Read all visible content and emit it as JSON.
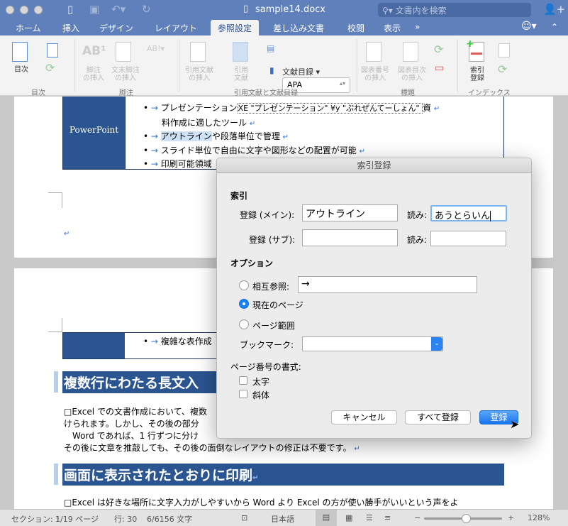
{
  "window": {
    "title": "sample14.docx",
    "search_placeholder": "文書内を検索"
  },
  "tabs": [
    {
      "label": "ホーム"
    },
    {
      "label": "挿入"
    },
    {
      "label": "デザイン"
    },
    {
      "label": "レイアウト"
    },
    {
      "label": "参照設定",
      "active": true
    },
    {
      "label": "差し込み文書"
    },
    {
      "label": "校閲"
    },
    {
      "label": "表示"
    },
    {
      "label": "»"
    }
  ],
  "ribbon": {
    "toc": {
      "button": "目次",
      "group": "目次"
    },
    "footnote": {
      "insert_footnote": "脚注\nの挿入",
      "insert_endnote": "文末脚注\nの挿入",
      "group": "脚注"
    },
    "citations": {
      "insert_citation": "引用文献\nの挿入",
      "citations": "引用\n文献",
      "style": "APA",
      "bibliography": "文献目録",
      "group": "引用文献と文献目録"
    },
    "captions": {
      "insert_caption": "図表番号\nの挿入",
      "insert_table_of_figures": "図表目次\nの挿入",
      "group": "標題"
    },
    "index": {
      "mark_entry": "索引\n登録",
      "group": "インデックス"
    }
  },
  "document": {
    "table1": {
      "cell": "PowerPoint",
      "bullets": [
        "プレゼンテーション",
        "XE \"プレゼンテーション\" ¥y \"ぷれぜんてーしょん\" ",
        "資",
        "料作成に適したツール",
        "アウトライン",
        "や段落単位で管理",
        "スライド単位で自由に文字や図形などの配置が可能",
        "印刷可能領域"
      ]
    },
    "table2": {
      "bullet": "複雑な表作成"
    },
    "heading1": "複数行にわたる長文入",
    "para1": [
      "□Excel での文書作成において、複数",
      "けられます。しかし、その後の部分",
      "　Word であれば、1 行ずつに分け",
      "その後に文章を推敲しても、その後の面倒なレイアウトの修正は不要です。"
    ],
    "heading2": "画面に表示されたとおりに印刷",
    "para2": "□Excel は好きな場所に文字入力がしやすいから Word より Excel の方が使い勝手がいいという声をよ"
  },
  "dialog": {
    "title": "索引登録",
    "index_section": "索引",
    "main_entry_label": "登録 (メイン):",
    "main_entry_value": "アウトライン",
    "reading_label": "読み:",
    "main_reading_value": "あうとらいん",
    "sub_entry_label": "登録 (サブ):",
    "sub_entry_value": "",
    "sub_reading_value": "",
    "options_section": "オプション",
    "cross_ref_label": "相互参照:",
    "cross_ref_value": "→",
    "current_page_label": "現在のページ",
    "page_range_label": "ページ範囲",
    "selected_option": "現在のページ",
    "bookmark_label": "ブックマーク:",
    "bookmark_value": "",
    "page_format_label": "ページ番号の書式:",
    "bold_label": "太字",
    "italic_label": "斜体",
    "bold_checked": false,
    "italic_checked": false,
    "cancel": "キャンセル",
    "mark_all": "すべて登録",
    "mark": "登録"
  },
  "status": {
    "section": "セクション: 1",
    "page": "1/19 ページ",
    "line": "行: 30",
    "words": "6/6156 文字",
    "language": "日本語",
    "zoom": "128%",
    "zoom_level": 128
  }
}
